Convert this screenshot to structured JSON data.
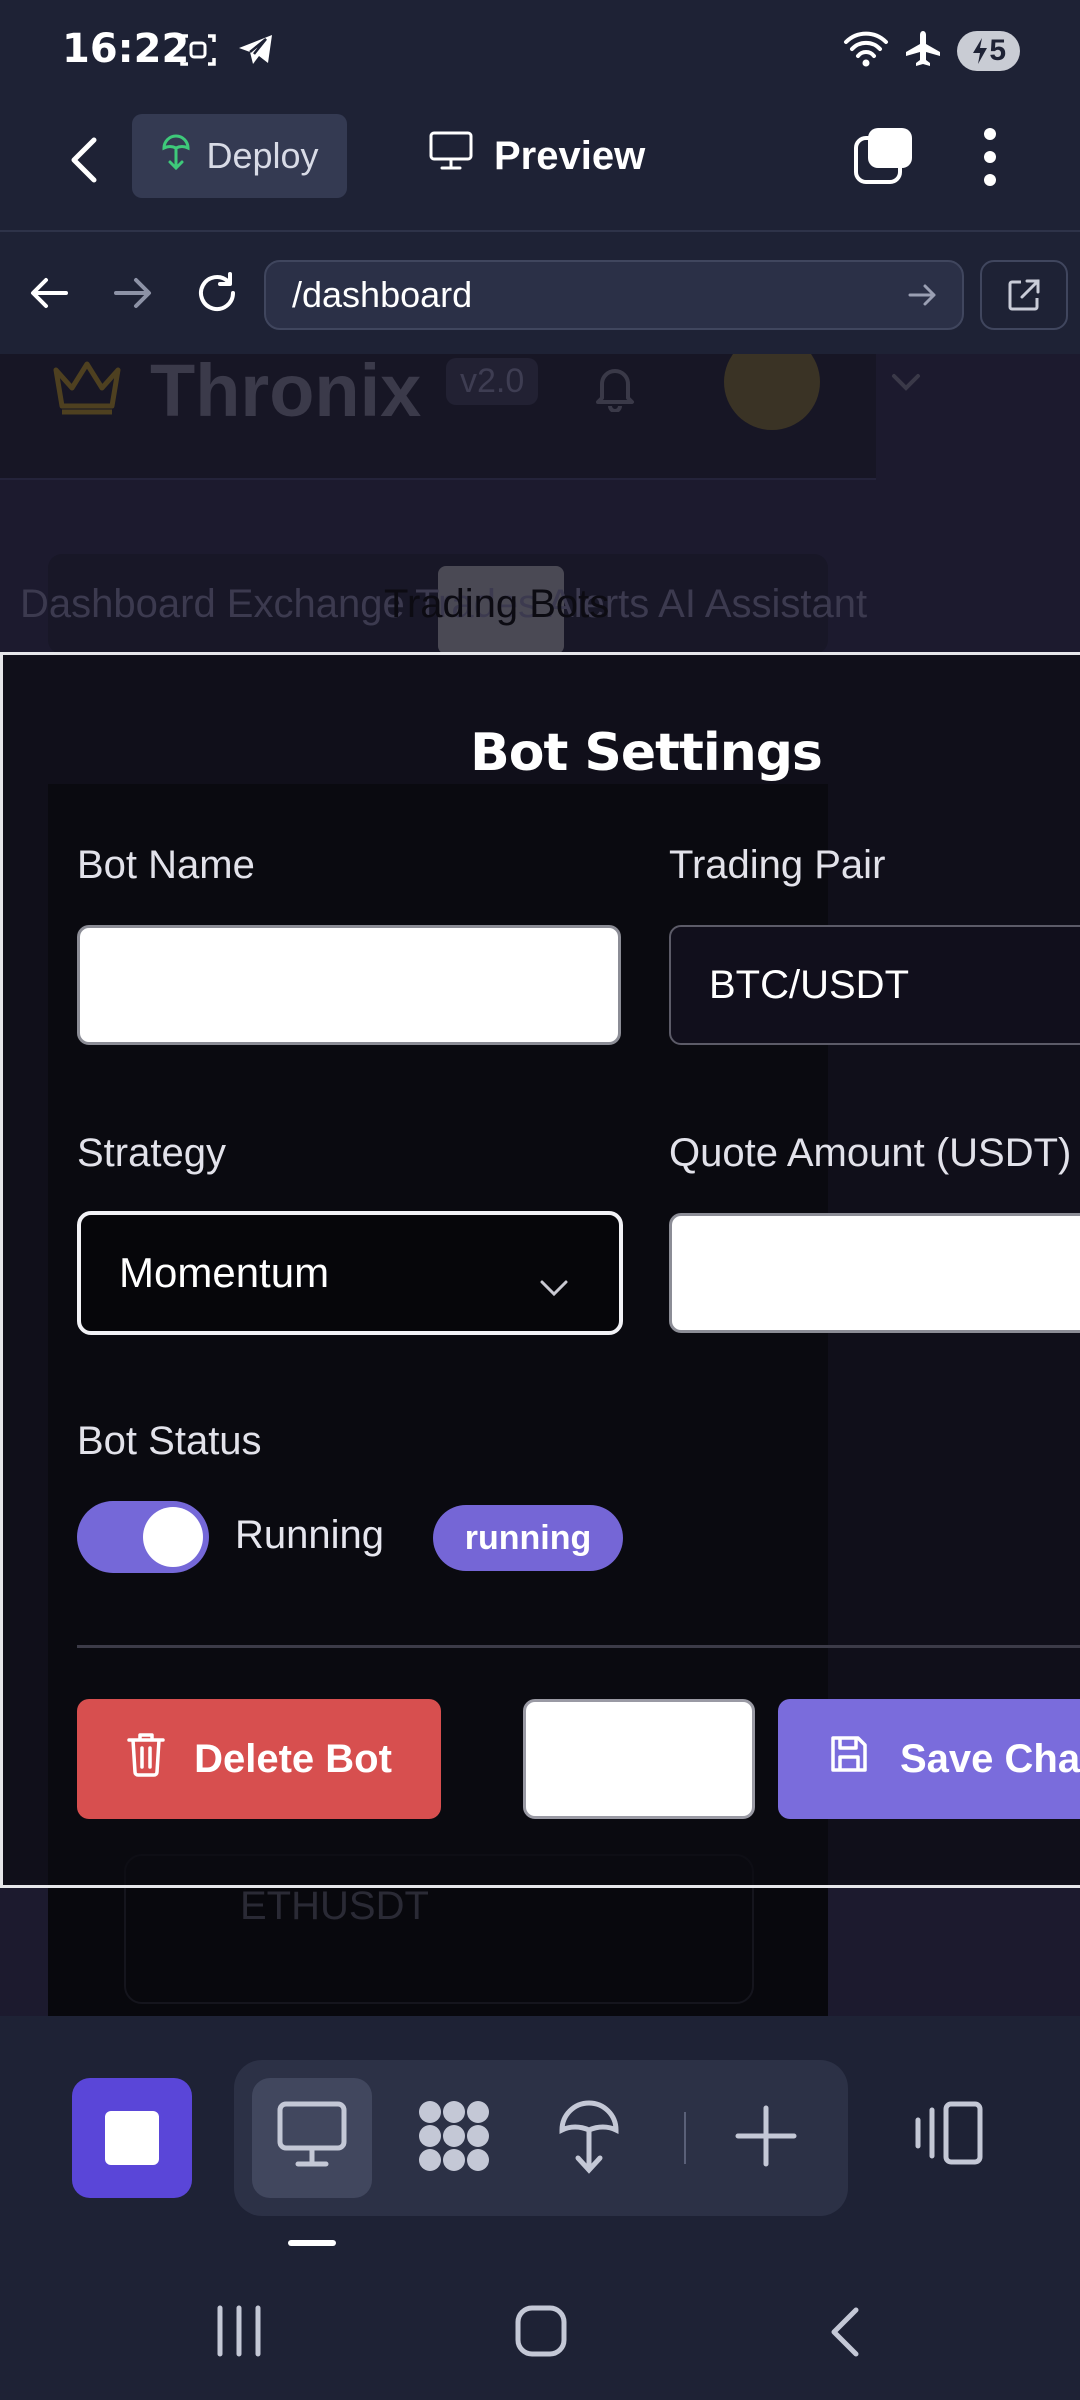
{
  "status_bar": {
    "time": "16:22",
    "battery": "5"
  },
  "app_bar": {
    "deploy_label": "Deploy",
    "preview_label": "Preview"
  },
  "url_bar": {
    "url": "/dashboard"
  },
  "site": {
    "brand": "Thronix",
    "version": "v2.0",
    "nav_overlap_text": "Dashboard Exchange Trades Alerts AI Assistant",
    "nav_active": "Trading Bots",
    "bg_symbol": "ETHUSDT"
  },
  "modal": {
    "title": "Bot Settings",
    "bot_name_label": "Bot Name",
    "bot_name_value": "",
    "trading_pair_label": "Trading Pair",
    "trading_pair_value": "BTC/USDT",
    "strategy_label": "Strategy",
    "strategy_value": "Momentum",
    "quote_label": "Quote Amount (USDT)",
    "quote_value": "",
    "status_label": "Bot Status",
    "toggle_on": true,
    "toggle_text": "Running",
    "status_badge": "running",
    "delete_label": "Delete Bot",
    "cancel_label": "",
    "save_label": "Save Changes"
  },
  "colors": {
    "accent": "#7a6cdc",
    "danger": "#d74f4f",
    "home_button": "#5a46d8"
  },
  "icons": {
    "status_left": [
      "screenshot-icon",
      "telegram-icon"
    ],
    "status_right": [
      "wifi-icon",
      "airplane-icon",
      "battery-icon"
    ],
    "toolbar": [
      "square-icon",
      "monitor-icon",
      "apps-icon",
      "deploy-icon",
      "plus-icon",
      "panel-icon"
    ]
  }
}
